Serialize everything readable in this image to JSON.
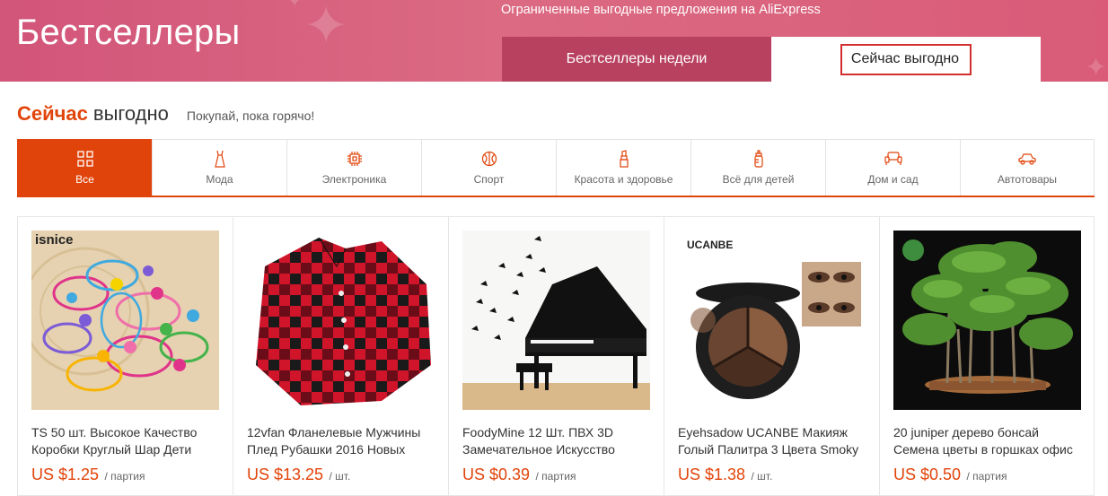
{
  "banner": {
    "title": "Бестселлеры",
    "subtitle": "Ограниченные выгодные предложения на AliExpress",
    "tabs": [
      {
        "label": "Бестселлеры недели"
      },
      {
        "label": "Сейчас выгодно"
      }
    ]
  },
  "section": {
    "title_accent": "Сейчас",
    "title_rest": "выгодно",
    "subtitle": "Покупай, пока горячо!"
  },
  "categories": [
    {
      "label": "Все",
      "icon": "grid-icon"
    },
    {
      "label": "Мода",
      "icon": "dress-icon"
    },
    {
      "label": "Электроника",
      "icon": "chip-icon"
    },
    {
      "label": "Спорт",
      "icon": "ball-icon"
    },
    {
      "label": "Красота и здоровье",
      "icon": "lipstick-icon"
    },
    {
      "label": "Всё для детей",
      "icon": "bottle-icon"
    },
    {
      "label": "Дом и сад",
      "icon": "sofa-icon"
    },
    {
      "label": "Автотовары",
      "icon": "car-icon"
    }
  ],
  "products": [
    {
      "title": "TS 50 шт. Высокое Качество Коробки Круглый Шар Дети",
      "price": "US $1.25",
      "unit": "/ партия",
      "brand": "isnice"
    },
    {
      "title": "12vfan Фланелевые Мужчины Плед Рубашки 2016 Новых",
      "price": "US $13.25",
      "unit": "/ шт."
    },
    {
      "title": "FoodyMine 12 Шт. ПВХ 3D Замечательное Искусство",
      "price": "US $0.39",
      "unit": "/ партия"
    },
    {
      "title": "Eyehsadow UCANBE Макияж Голый Палитра 3 Цвета Smoky",
      "price": "US $1.38",
      "unit": "/ шт.",
      "brand": "UCANBE"
    },
    {
      "title": "20 juniper дерево бонсай Семена цветы в горшках офис",
      "price": "US $0.50",
      "unit": "/ партия"
    }
  ],
  "colors": {
    "banner": "#d95b78",
    "tab_dark": "#b8415f",
    "accent": "#e1440a",
    "highlight_border": "#d32f2f"
  }
}
